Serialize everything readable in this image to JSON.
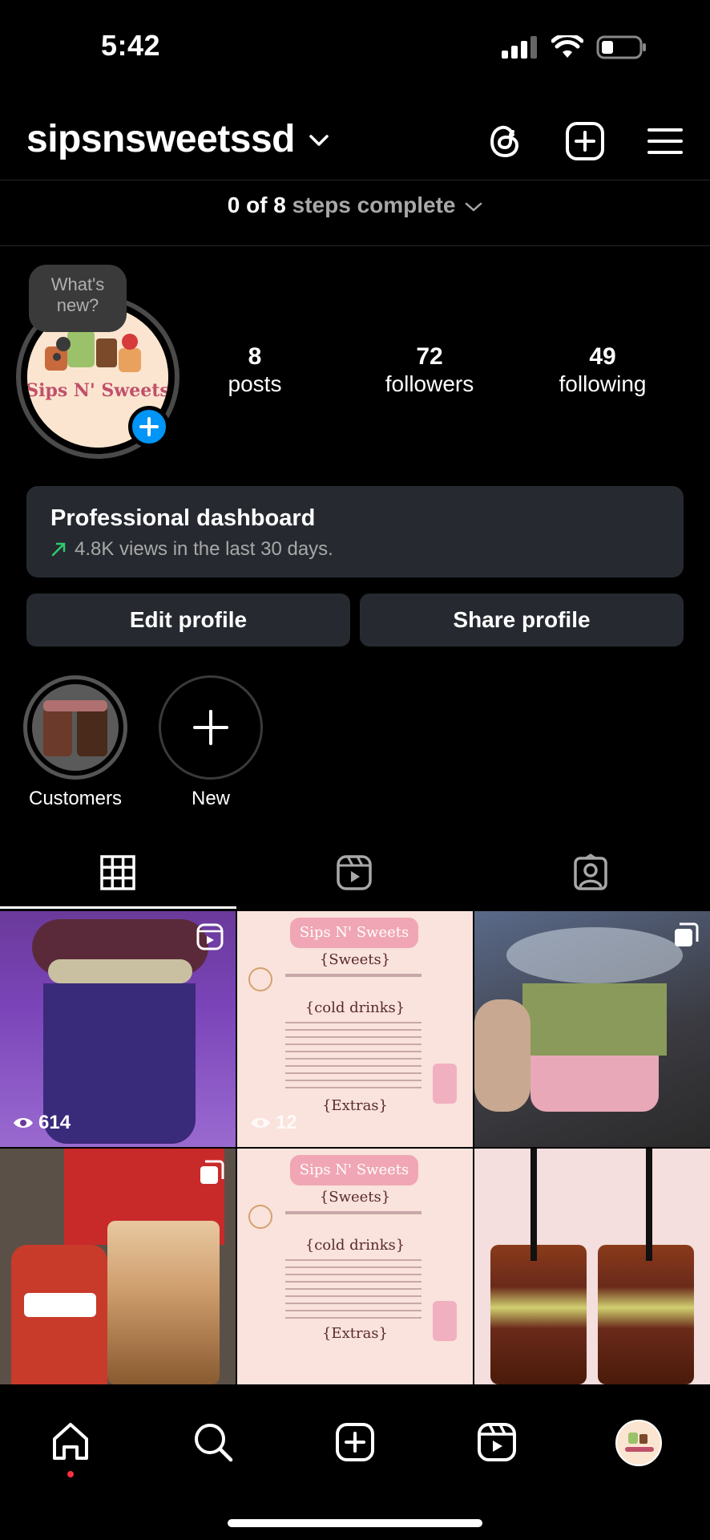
{
  "status_bar": {
    "time": "5:42"
  },
  "header": {
    "username": "sipsnsweetssd"
  },
  "steps": {
    "progress": "0 of 8",
    "label": "steps complete"
  },
  "profile": {
    "whats_new": "What's new?",
    "avatar_text": "Sips N' Sweets",
    "stats": [
      {
        "value": "8",
        "label": "posts"
      },
      {
        "value": "72",
        "label": "followers"
      },
      {
        "value": "49",
        "label": "following"
      }
    ]
  },
  "dashboard": {
    "title": "Professional dashboard",
    "subtitle": "4.8K views in the last 30 days."
  },
  "buttons": {
    "edit": "Edit profile",
    "share": "Share profile"
  },
  "highlights": [
    {
      "label": "Customers"
    },
    {
      "label": "New"
    }
  ],
  "tabs": [
    "grid",
    "reels",
    "tagged"
  ],
  "posts": [
    {
      "type": "reel",
      "views": "614"
    },
    {
      "type": "reel",
      "views": "12",
      "menu_title": "Sips N' Sweets",
      "menu_sections": [
        "{Sweets}",
        "{cold drinks}",
        "{Extras}"
      ]
    },
    {
      "type": "carousel"
    },
    {
      "type": "carousel"
    },
    {
      "type": "image",
      "menu_title": "Sips N' Sweets",
      "menu_sections": [
        "{Sweets}",
        "{cold drinks}",
        "{Extras}"
      ]
    },
    {
      "type": "image"
    }
  ],
  "colors": {
    "accent_blue": "#0095f6",
    "surface": "#262a30",
    "trend_green": "#2ecc71",
    "notif_red": "#ff3040"
  },
  "nav": [
    "home",
    "search",
    "create",
    "reels",
    "profile"
  ]
}
